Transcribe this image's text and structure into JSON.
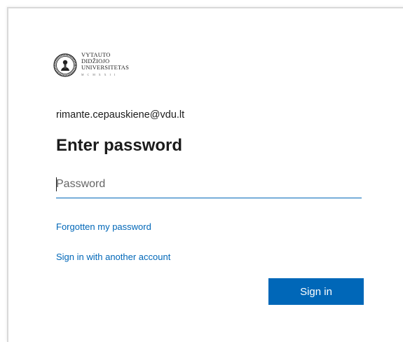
{
  "brand": {
    "logo_lines": [
      "VYTAUTO",
      "DIDŽIOJO",
      "UNIVERSITETAS"
    ],
    "motto": "M C M X X I I"
  },
  "account": {
    "email": "rimante.cepauskiene@vdu.lt"
  },
  "form": {
    "title": "Enter password",
    "password_placeholder": "Password",
    "password_value": "",
    "forgot_link": "Forgotten my password",
    "another_account_link": "Sign in with another account",
    "submit_label": "Sign in"
  },
  "colors": {
    "accent": "#0067b8",
    "text": "#1b1b1b",
    "background": "#ffffff"
  }
}
